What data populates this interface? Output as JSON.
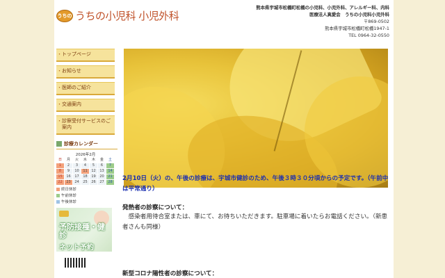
{
  "header": {
    "logo_badge": "うちの",
    "logo_text": "うちの小児科 小児外科",
    "info_line1": "熊本県宇城市松橋町松橋の小児科、小児外科、アレルギー科、内科",
    "info_line2": "医療法人真愛会　うちの小児科小児外科",
    "postal": "〒869-0502",
    "address": "熊本県宇城市松橋町松橋1947-1",
    "tel": "TEL 0964-32-0550"
  },
  "nav": {
    "items": [
      {
        "label": "トップページ"
      },
      {
        "label": "お知らせ"
      },
      {
        "label": "医師のご紹介"
      },
      {
        "label": "交通案内"
      },
      {
        "label": "診察受付サービスのご案内"
      }
    ]
  },
  "calendar": {
    "title": "診療カレンダー",
    "month": "2026年2月",
    "weekdays": [
      "日",
      "月",
      "火",
      "水",
      "木",
      "金",
      "土"
    ],
    "days": [
      "1",
      "2",
      "3",
      "4",
      "5",
      "6",
      "7",
      "8",
      "9",
      "10",
      "11",
      "12",
      "13",
      "14",
      "15",
      "16",
      "17",
      "18",
      "19",
      "20",
      "21",
      "22",
      "23",
      "24",
      "25",
      "26",
      "27",
      "28"
    ],
    "legend": [
      "終日休診",
      "午前休診",
      "午後休診"
    ],
    "colors": {
      "closed": "#f3a17a",
      "am_closed": "#9ccc8a",
      "pm_closed": "#9fc3e6"
    }
  },
  "banner": {
    "line1": "予防接種・健診",
    "line2": "ネット予約"
  },
  "main": {
    "notice": "2月10日（火）の、午後の診療は、宇城市健診のため、午後３時３０分頃からの予定です。（午前中は平常通り）",
    "section1_title": "発熱者の診察について：",
    "section1_body": "　感染者用待合室または、車にて、お待ちいただきます。駐車場に着いたらお電話ください。（新患者さんも同様）",
    "section2_title": "新型コロナ陽性者の診察について："
  }
}
